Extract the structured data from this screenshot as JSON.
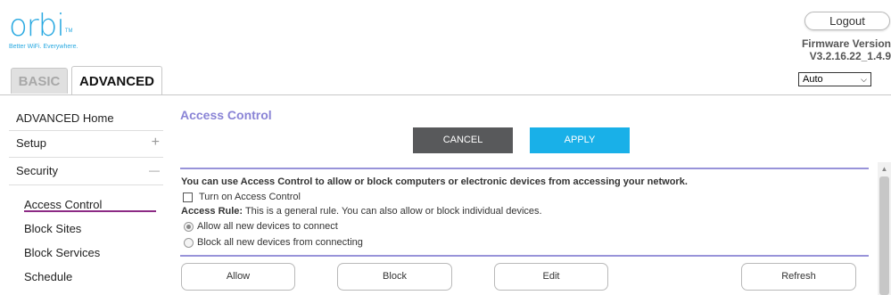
{
  "header": {
    "logo_word": "orbi",
    "logo_tm": "TM",
    "logo_tagline": "Better WiFi. Everywhere.",
    "logout_label": "Logout",
    "firmware_label": "Firmware Version",
    "firmware_value": "V3.2.16.22_1.4.9",
    "language_selected": "Auto"
  },
  "tabs": {
    "basic": "BASIC",
    "advanced": "ADVANCED"
  },
  "sidebar": {
    "items": [
      {
        "label": "ADVANCED Home"
      },
      {
        "label": "Setup",
        "toggle": "+"
      },
      {
        "label": "Security",
        "toggle": "—"
      }
    ],
    "sub_items": [
      {
        "label": "Access Control",
        "active": true
      },
      {
        "label": "Block Sites"
      },
      {
        "label": "Block Services"
      },
      {
        "label": "Schedule"
      }
    ]
  },
  "main": {
    "title": "Access Control",
    "cancel_label": "CANCEL",
    "apply_label": "APPLY",
    "description": "You can use Access Control to allow or block computers or electronic devices from accessing your network.",
    "turn_on_label": "Turn on Access Control",
    "turn_on_checked": false,
    "rule_label": "Access Rule:",
    "rule_text": " This is a general rule. You can also allow or block individual devices.",
    "radio_allow": "Allow all new devices to connect",
    "radio_block": "Block all new devices from connecting",
    "radio_selected": "allow",
    "buttons": {
      "allow": "Allow",
      "block": "Block",
      "edit": "Edit",
      "refresh": "Refresh"
    }
  },
  "colors": {
    "logo_blue": "#29a9e1",
    "title_purple": "#8a84d6",
    "apply_blue": "#19b0e8",
    "cancel_gray": "#58595b",
    "active_underline": "#8c2a84"
  }
}
